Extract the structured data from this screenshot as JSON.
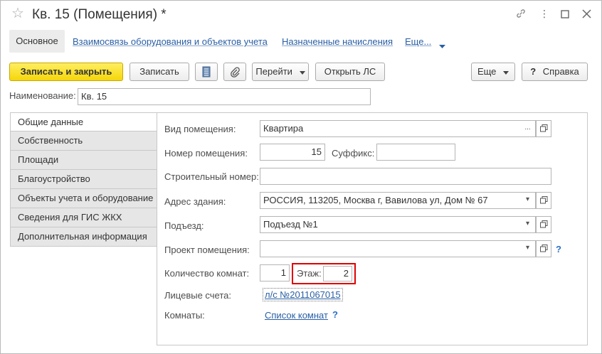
{
  "window": {
    "title": "Кв. 15 (Помещения) *"
  },
  "nav": {
    "main_tab": "Основное",
    "links": [
      "Взаимосвязь оборудования и объектов учета",
      "Назначенные начисления"
    ],
    "more": "Еще..."
  },
  "toolbar": {
    "save_close": "Записать и закрыть",
    "save": "Записать",
    "goto": "Перейти",
    "open_ls": "Открыть ЛС",
    "more": "Еще",
    "help": "Справка"
  },
  "name_field": {
    "label": "Наименование:",
    "value": "Кв. 15"
  },
  "side_tabs": [
    "Общие данные",
    "Собственность",
    "Площади",
    "Благоустройство",
    "Объекты учета и оборудование",
    "Сведения для ГИС ЖКХ",
    "Дополнительная информация"
  ],
  "form": {
    "room_type_label": "Вид помещения:",
    "room_type_value": "Квартира",
    "room_number_label": "Номер помещения:",
    "room_number_value": "15",
    "suffix_label": "Суффикс:",
    "suffix_value": "",
    "build_number_label": "Строительный номер:",
    "build_number_value": "",
    "address_label": "Адрес здания:",
    "address_value": "РОССИЯ, 113205, Москва г, Вавилова ул, Дом № 67",
    "entrance_label": "Подъезд:",
    "entrance_value": "Подъезд №1",
    "project_label": "Проект помещения:",
    "project_value": "",
    "rooms_count_label": "Количество комнат:",
    "rooms_count_value": "1",
    "floor_label": "Этаж:",
    "floor_value": "2",
    "accounts_label": "Лицевые счета:",
    "accounts_value": "л/с №2011067015",
    "rooms_label": "Комнаты:",
    "rooms_link": "Список комнат"
  },
  "colors": {
    "primary_button": "#f5d60a",
    "link": "#2a5fa4",
    "highlight_border": "#e00000"
  }
}
